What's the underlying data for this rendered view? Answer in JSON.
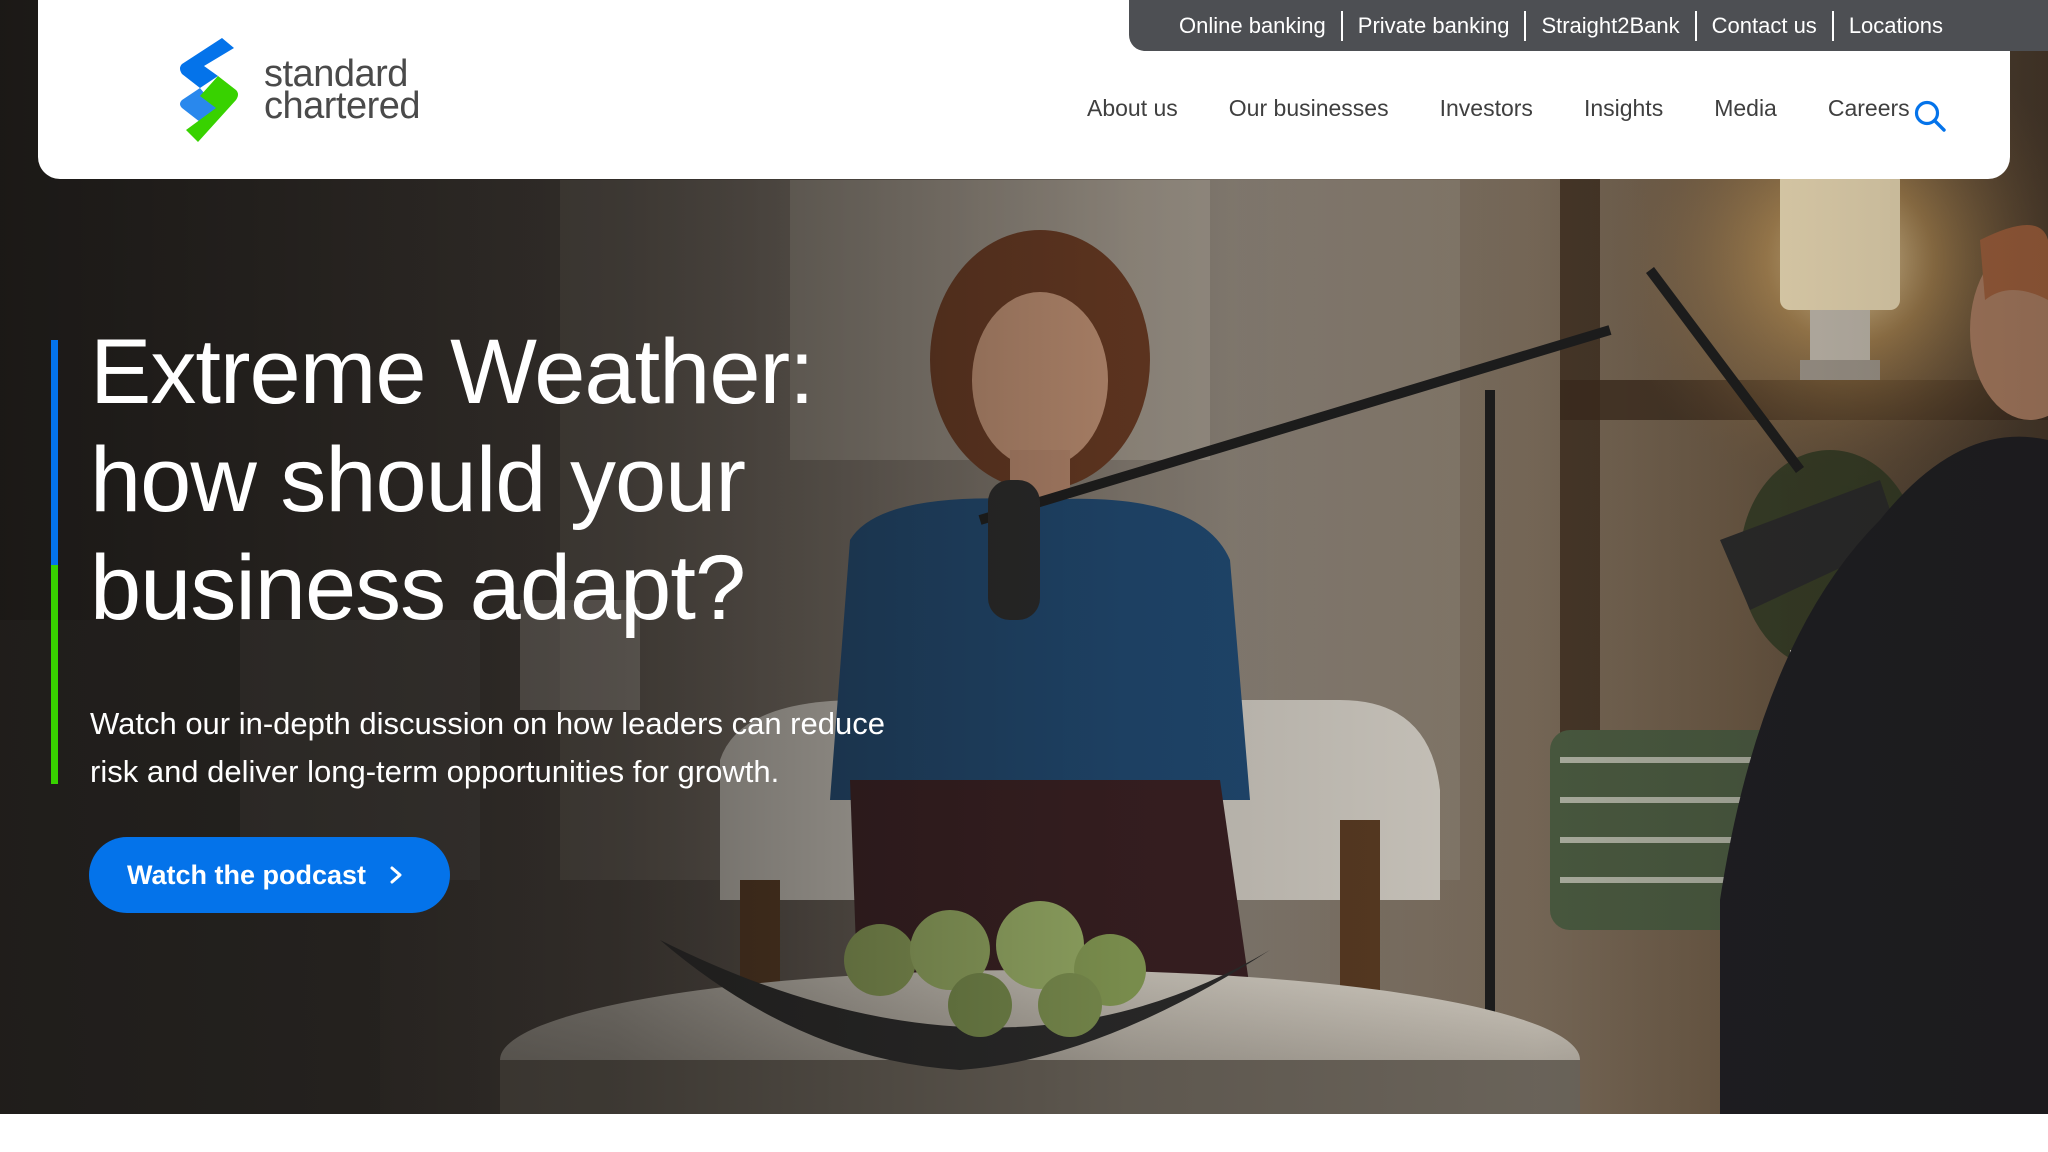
{
  "brand": {
    "name_line1": "standard",
    "name_line2": "chartered",
    "logo_icon": "standard-chartered-logo-icon",
    "colors": {
      "blue": "#0473ea",
      "green": "#38d200",
      "utility_bar": "#4d4f53"
    }
  },
  "utility_nav": {
    "items": [
      {
        "label": "Online banking"
      },
      {
        "label": "Private banking"
      },
      {
        "label": "Straight2Bank"
      },
      {
        "label": "Contact us"
      },
      {
        "label": "Locations"
      }
    ]
  },
  "main_nav": {
    "items": [
      {
        "label": "About us"
      },
      {
        "label": "Our businesses"
      },
      {
        "label": "Investors"
      },
      {
        "label": "Insights"
      },
      {
        "label": "Media"
      },
      {
        "label": "Careers"
      }
    ],
    "search_icon": "search-icon"
  },
  "hero": {
    "title_lines": [
      "Extreme Weather:",
      "how should your",
      "business adapt?"
    ],
    "description_line1": "Watch our in-depth discussion on how leaders can reduce",
    "description_line2": "risk and deliver long-term opportunities for growth.",
    "cta": {
      "label": "Watch the podcast",
      "icon": "chevron-right-icon"
    }
  }
}
